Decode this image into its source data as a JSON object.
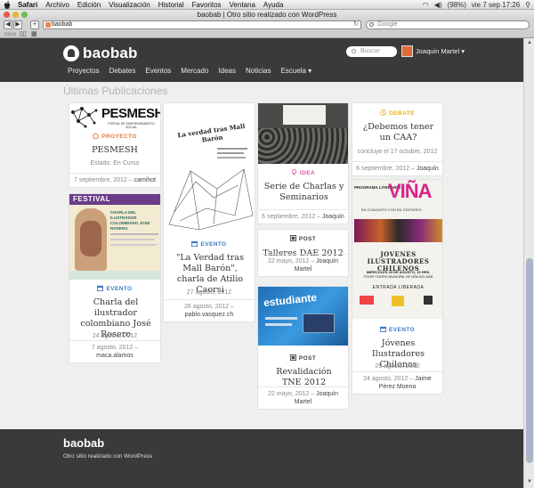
{
  "menubar": {
    "items": [
      "Safari",
      "Archivo",
      "Edición",
      "Visualización",
      "Historial",
      "Favoritos",
      "Ventana",
      "Ayuda"
    ],
    "battery": "(98%)",
    "clock": "vie 7 sep  17:26"
  },
  "browser": {
    "window_title": "baobab | Otro sitio realizado con WordPress",
    "url": "baobab",
    "search_placeholder": "Google"
  },
  "site": {
    "logo": "baobab",
    "nav": [
      "Proyectos",
      "Debates",
      "Eventos",
      "Mercado",
      "Ideas",
      "Noticias",
      "Escuela ▾"
    ],
    "search_placeholder": "Buscar",
    "user_name": "Joaquin Martel ▾",
    "section_title": "Últimas Publicaciones"
  },
  "cards": {
    "pesmesh": {
      "thumb_title": "PESMESH",
      "thumb_sub": "PORTAL DE EMPRENDIMIENTO SOCIAL",
      "category": "PROYECTO",
      "title": "PESMESH",
      "status": "Estado: En Curso",
      "date": "7 septiembre, 2012 –",
      "author": "camihot"
    },
    "charla": {
      "poster_title": "FESTIVAL",
      "poster_sub": "CHARLA DEL ILUSTRADOR COLOMBIANO JOSE ROSERO",
      "category": "EVENTO",
      "title": "Charla del ilustrador colombiano José Rosero",
      "meta": "24 agosto, 2012",
      "date": "7 agosto, 2012 –",
      "author": "maca.alamos"
    },
    "verdad": {
      "doc_title": "La verdad tras Mall Barón",
      "category": "EVENTO",
      "title": "\"La Verdad tras Mall Barón\", charla de Atilio Caorsi",
      "meta": "27 agosto, 2012",
      "date": "26 agosto, 2012 –",
      "author": "pablo.vasquez.ch"
    },
    "serie": {
      "category": "IDEA",
      "title": "Serie de Charlas y Seminarios",
      "date": "6 septiembre, 2012 –",
      "author": "Joaquín"
    },
    "talleres": {
      "category": "POST",
      "title": "Talleres DAE 2012",
      "date": "22 mayo, 2012 –",
      "author": "Joaquín Martel"
    },
    "tne": {
      "thumb_text": "estudiante",
      "category": "POST",
      "title": "Revalidación TNE 2012",
      "date": "22 mayo, 2012 –",
      "author": "Joaquín Martel"
    },
    "debate": {
      "category": "DEBATE",
      "title": "¿Debemos tener un CAA?",
      "meta": "concluye el 17 octubre, 2012",
      "date": "6 septiembre, 2012 –",
      "author": "Joaquín"
    },
    "jovenes": {
      "poster_top": "PROGRAMA LITERARIO",
      "poster_big": "VIÑA",
      "poster_mid": "EN CONJUNTO CON RIL EDITORES",
      "poster_head": "JOVENES ILUSTRADORES CHILENOS",
      "poster_date": "MIÉRCOLES 29 DE AGOSTO, 19 HRS.",
      "poster_place": "FOYER TEATRO MUNICIPAL DE VIÑA DEL MAR",
      "poster_entry": "ENTRADA LIBERADA",
      "category": "EVENTO",
      "title": "Jóvenes Ilustradores Chilenos",
      "meta": "29 agosto, 2012",
      "date": "24 agosto, 2012 –",
      "author": "Jaime Pérez Moena"
    }
  },
  "footer": {
    "logo": "baobab",
    "tagline": "Otro sitio realizado con WordPress"
  },
  "colors": {
    "header_bg": "#3a3a3a",
    "proyecto": "#e07a3a",
    "evento": "#3a78c4",
    "idea": "#d956a8",
    "debate": "#e8b020",
    "post": "#444444"
  }
}
